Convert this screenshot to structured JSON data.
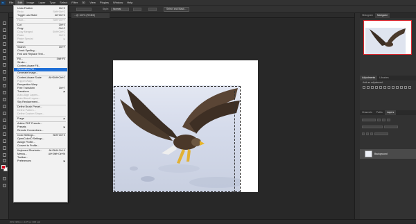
{
  "menubar": {
    "logo": "Ps",
    "items": [
      "File",
      "Edit",
      "Image",
      "Layer",
      "Type",
      "Select",
      "Filter",
      "3D",
      "View",
      "Plugins",
      "Window",
      "Help"
    ]
  },
  "options_bar": {
    "style_label": "Style:",
    "style_value": "Normal",
    "select_mask_label": "Select and Mask..."
  },
  "document_tab": {
    "label": "...@ 100% (RGB/8)"
  },
  "status_bar": {
    "text": "20%     1980 px x 1476 px (300 ppi)"
  },
  "panels": {
    "top_tabs": [
      "Histogram",
      "Navigator"
    ],
    "mid_tabs": [
      "Adjustments",
      "Libraries"
    ],
    "adjustments_sub": "Add an adjustment",
    "layers_tabs": [
      "Channels",
      "Paths",
      "Layers"
    ],
    "layer_name": "Background"
  },
  "edit_menu": {
    "items": [
      {
        "label": "Undo Feather",
        "shortcut": "Ctrl+Z",
        "disabled": false
      },
      {
        "label": "Redo",
        "shortcut": "Shift+Ctrl+Z",
        "disabled": true
      },
      {
        "label": "Toggle Last State",
        "shortcut": "Alt+Ctrl+Z",
        "disabled": false
      },
      {
        "sep": true
      },
      {
        "label": "Fade...",
        "shortcut": "Shift+Ctrl+F",
        "disabled": true
      },
      {
        "sep": true
      },
      {
        "label": "Cut",
        "shortcut": "Ctrl+X",
        "disabled": false
      },
      {
        "label": "Copy",
        "shortcut": "Ctrl+C",
        "disabled": false
      },
      {
        "label": "Copy Merged",
        "shortcut": "Shift+Ctrl+C",
        "disabled": true
      },
      {
        "label": "Paste",
        "shortcut": "Ctrl+V",
        "disabled": true
      },
      {
        "label": "Paste Special",
        "shortcut": "",
        "disabled": true,
        "submenu": true
      },
      {
        "label": "Clear",
        "shortcut": "",
        "disabled": false
      },
      {
        "sep": true
      },
      {
        "label": "Search",
        "shortcut": "Ctrl+F",
        "disabled": false
      },
      {
        "label": "Check Spelling...",
        "shortcut": "",
        "disabled": false
      },
      {
        "label": "Find and Replace Text...",
        "shortcut": "",
        "disabled": false
      },
      {
        "sep": true
      },
      {
        "label": "Fill...",
        "shortcut": "Shift+F5",
        "disabled": false
      },
      {
        "label": "Stroke...",
        "shortcut": "",
        "disabled": false
      },
      {
        "label": "Content-Aware Fill...",
        "shortcut": "",
        "disabled": false
      },
      {
        "label": "Generative Fill...",
        "shortcut": "",
        "disabled": false,
        "highlight": true
      },
      {
        "label": "Generate Image...",
        "shortcut": "",
        "disabled": false
      },
      {
        "sep": true
      },
      {
        "label": "Content-Aware Scale",
        "shortcut": "Alt+Shift+Ctrl+C",
        "disabled": false
      },
      {
        "label": "Puppet Warp",
        "shortcut": "",
        "disabled": true
      },
      {
        "label": "Perspective Warp",
        "shortcut": "",
        "disabled": false
      },
      {
        "label": "Free Transform",
        "shortcut": "Ctrl+T",
        "disabled": false
      },
      {
        "label": "Transform",
        "shortcut": "",
        "disabled": false,
        "submenu": true
      },
      {
        "label": "Auto-Align Layers...",
        "shortcut": "",
        "disabled": true
      },
      {
        "label": "Auto-Blend Layers...",
        "shortcut": "",
        "disabled": true
      },
      {
        "label": "Sky Replacement...",
        "shortcut": "",
        "disabled": false
      },
      {
        "sep": true
      },
      {
        "label": "Define Brush Preset...",
        "shortcut": "",
        "disabled": false
      },
      {
        "label": "Define Pattern...",
        "shortcut": "",
        "disabled": true
      },
      {
        "label": "Define Custom Shape...",
        "shortcut": "",
        "disabled": true
      },
      {
        "sep": true
      },
      {
        "label": "Purge",
        "shortcut": "",
        "disabled": false,
        "submenu": true
      },
      {
        "sep": true
      },
      {
        "label": "Adobe PDF Presets...",
        "shortcut": "",
        "disabled": false
      },
      {
        "label": "Presets",
        "shortcut": "",
        "disabled": false,
        "submenu": true
      },
      {
        "label": "Remote Connections...",
        "shortcut": "",
        "disabled": false
      },
      {
        "sep": true
      },
      {
        "label": "Color Settings...",
        "shortcut": "Shift+Ctrl+K",
        "disabled": false
      },
      {
        "label": "OpenColorIO Settings...",
        "shortcut": "",
        "disabled": false
      },
      {
        "label": "Assign Profile...",
        "shortcut": "",
        "disabled": false
      },
      {
        "label": "Convert to Profile...",
        "shortcut": "",
        "disabled": false
      },
      {
        "sep": true
      },
      {
        "label": "Keyboard Shortcuts...",
        "shortcut": "Alt+Shift+Ctrl+K",
        "disabled": false
      },
      {
        "label": "Menus...",
        "shortcut": "Alt+Shift+Ctrl+M",
        "disabled": false
      },
      {
        "label": "Toolbar...",
        "shortcut": "",
        "disabled": false
      },
      {
        "label": "Preferences",
        "shortcut": "",
        "disabled": false,
        "submenu": true
      }
    ]
  },
  "colors": {
    "menu_highlight": "#1f6fd6",
    "foreground_swatch": "#d4001c",
    "background_swatch": "#ffffff",
    "navigator_frame": "#d9262d"
  }
}
